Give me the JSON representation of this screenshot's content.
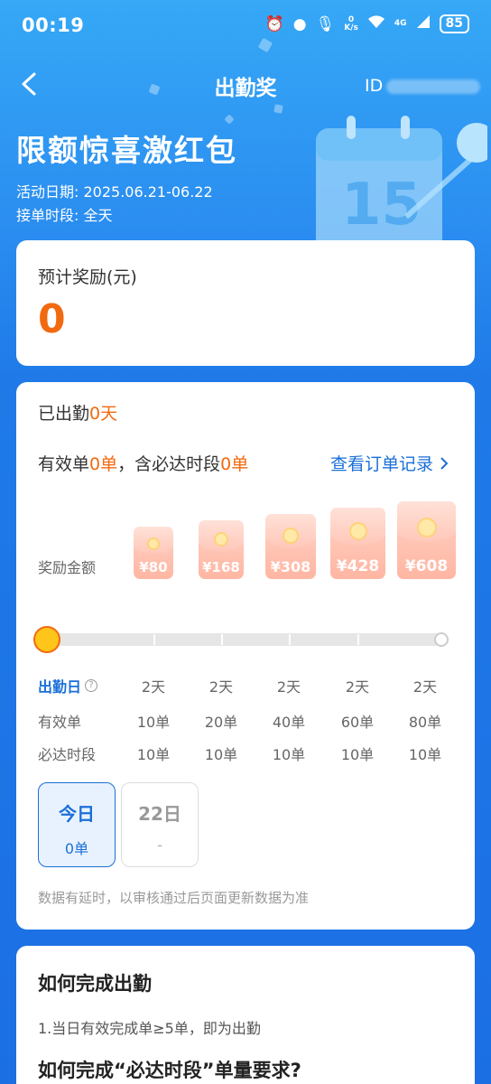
{
  "status_bar": {
    "time": "00:19",
    "net_speed_top": "0",
    "net_speed_bottom": "K/s",
    "signal": "4G",
    "battery": "85"
  },
  "nav": {
    "title": "出勤奖",
    "id_label": "ID"
  },
  "hero": {
    "title": "限额惊喜激红包",
    "date_line": "活动日期: 2025.06.21-06.22",
    "period_line": "接单时段: 全天"
  },
  "reward": {
    "label": "预计奖励(元)",
    "value": "0"
  },
  "attendance": {
    "prefix": "已出勤",
    "days": "0天",
    "valid_prefix": "有效单",
    "valid_count": "0单",
    "valid_middle": "，含必达时段",
    "must_count": "0单",
    "records_link": "查看订单记录"
  },
  "tiers": {
    "amount_label": "奖励金额",
    "amounts": [
      "¥80",
      "¥168",
      "¥308",
      "¥428",
      "¥608"
    ],
    "progress_fraction": 0,
    "rows": [
      {
        "label": "出勤日",
        "values": [
          "2天",
          "2天",
          "2天",
          "2天",
          "2天"
        ]
      },
      {
        "label": "有效单",
        "values": [
          "10单",
          "20单",
          "40单",
          "60单",
          "80单"
        ]
      },
      {
        "label": "必达时段",
        "values": [
          "10单",
          "10单",
          "10单",
          "10单",
          "10单"
        ]
      }
    ]
  },
  "days": [
    {
      "day": "今日",
      "value": "0单"
    },
    {
      "day": "22日",
      "value": "-"
    }
  ],
  "delay_note": "数据有延时，以审核通过后页面更新数据为准",
  "how": {
    "title1": "如何完成出勤",
    "item1": "1.当日有效完成单≥5单，即为出勤",
    "title2": "如何完成“必达时段”单量要求?"
  }
}
